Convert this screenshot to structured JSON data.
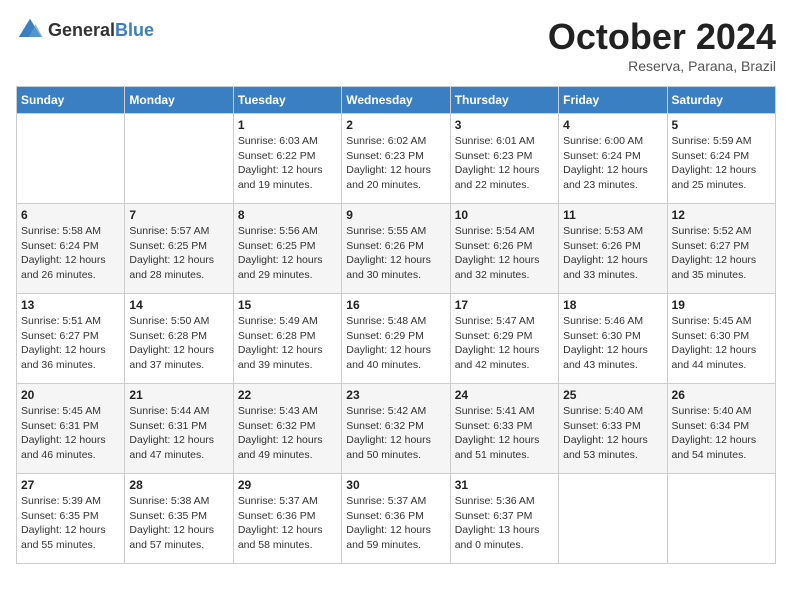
{
  "header": {
    "logo_general": "General",
    "logo_blue": "Blue",
    "title": "October 2024",
    "location": "Reserva, Parana, Brazil"
  },
  "weekdays": [
    "Sunday",
    "Monday",
    "Tuesday",
    "Wednesday",
    "Thursday",
    "Friday",
    "Saturday"
  ],
  "weeks": [
    [
      {
        "day": null,
        "info": null
      },
      {
        "day": null,
        "info": null
      },
      {
        "day": "1",
        "info": "Sunrise: 6:03 AM\nSunset: 6:22 PM\nDaylight: 12 hours and 19 minutes."
      },
      {
        "day": "2",
        "info": "Sunrise: 6:02 AM\nSunset: 6:23 PM\nDaylight: 12 hours and 20 minutes."
      },
      {
        "day": "3",
        "info": "Sunrise: 6:01 AM\nSunset: 6:23 PM\nDaylight: 12 hours and 22 minutes."
      },
      {
        "day": "4",
        "info": "Sunrise: 6:00 AM\nSunset: 6:24 PM\nDaylight: 12 hours and 23 minutes."
      },
      {
        "day": "5",
        "info": "Sunrise: 5:59 AM\nSunset: 6:24 PM\nDaylight: 12 hours and 25 minutes."
      }
    ],
    [
      {
        "day": "6",
        "info": "Sunrise: 5:58 AM\nSunset: 6:24 PM\nDaylight: 12 hours and 26 minutes."
      },
      {
        "day": "7",
        "info": "Sunrise: 5:57 AM\nSunset: 6:25 PM\nDaylight: 12 hours and 28 minutes."
      },
      {
        "day": "8",
        "info": "Sunrise: 5:56 AM\nSunset: 6:25 PM\nDaylight: 12 hours and 29 minutes."
      },
      {
        "day": "9",
        "info": "Sunrise: 5:55 AM\nSunset: 6:26 PM\nDaylight: 12 hours and 30 minutes."
      },
      {
        "day": "10",
        "info": "Sunrise: 5:54 AM\nSunset: 6:26 PM\nDaylight: 12 hours and 32 minutes."
      },
      {
        "day": "11",
        "info": "Sunrise: 5:53 AM\nSunset: 6:26 PM\nDaylight: 12 hours and 33 minutes."
      },
      {
        "day": "12",
        "info": "Sunrise: 5:52 AM\nSunset: 6:27 PM\nDaylight: 12 hours and 35 minutes."
      }
    ],
    [
      {
        "day": "13",
        "info": "Sunrise: 5:51 AM\nSunset: 6:27 PM\nDaylight: 12 hours and 36 minutes."
      },
      {
        "day": "14",
        "info": "Sunrise: 5:50 AM\nSunset: 6:28 PM\nDaylight: 12 hours and 37 minutes."
      },
      {
        "day": "15",
        "info": "Sunrise: 5:49 AM\nSunset: 6:28 PM\nDaylight: 12 hours and 39 minutes."
      },
      {
        "day": "16",
        "info": "Sunrise: 5:48 AM\nSunset: 6:29 PM\nDaylight: 12 hours and 40 minutes."
      },
      {
        "day": "17",
        "info": "Sunrise: 5:47 AM\nSunset: 6:29 PM\nDaylight: 12 hours and 42 minutes."
      },
      {
        "day": "18",
        "info": "Sunrise: 5:46 AM\nSunset: 6:30 PM\nDaylight: 12 hours and 43 minutes."
      },
      {
        "day": "19",
        "info": "Sunrise: 5:45 AM\nSunset: 6:30 PM\nDaylight: 12 hours and 44 minutes."
      }
    ],
    [
      {
        "day": "20",
        "info": "Sunrise: 5:45 AM\nSunset: 6:31 PM\nDaylight: 12 hours and 46 minutes."
      },
      {
        "day": "21",
        "info": "Sunrise: 5:44 AM\nSunset: 6:31 PM\nDaylight: 12 hours and 47 minutes."
      },
      {
        "day": "22",
        "info": "Sunrise: 5:43 AM\nSunset: 6:32 PM\nDaylight: 12 hours and 49 minutes."
      },
      {
        "day": "23",
        "info": "Sunrise: 5:42 AM\nSunset: 6:32 PM\nDaylight: 12 hours and 50 minutes."
      },
      {
        "day": "24",
        "info": "Sunrise: 5:41 AM\nSunset: 6:33 PM\nDaylight: 12 hours and 51 minutes."
      },
      {
        "day": "25",
        "info": "Sunrise: 5:40 AM\nSunset: 6:33 PM\nDaylight: 12 hours and 53 minutes."
      },
      {
        "day": "26",
        "info": "Sunrise: 5:40 AM\nSunset: 6:34 PM\nDaylight: 12 hours and 54 minutes."
      }
    ],
    [
      {
        "day": "27",
        "info": "Sunrise: 5:39 AM\nSunset: 6:35 PM\nDaylight: 12 hours and 55 minutes."
      },
      {
        "day": "28",
        "info": "Sunrise: 5:38 AM\nSunset: 6:35 PM\nDaylight: 12 hours and 57 minutes."
      },
      {
        "day": "29",
        "info": "Sunrise: 5:37 AM\nSunset: 6:36 PM\nDaylight: 12 hours and 58 minutes."
      },
      {
        "day": "30",
        "info": "Sunrise: 5:37 AM\nSunset: 6:36 PM\nDaylight: 12 hours and 59 minutes."
      },
      {
        "day": "31",
        "info": "Sunrise: 5:36 AM\nSunset: 6:37 PM\nDaylight: 13 hours and 0 minutes."
      },
      {
        "day": null,
        "info": null
      },
      {
        "day": null,
        "info": null
      }
    ]
  ]
}
